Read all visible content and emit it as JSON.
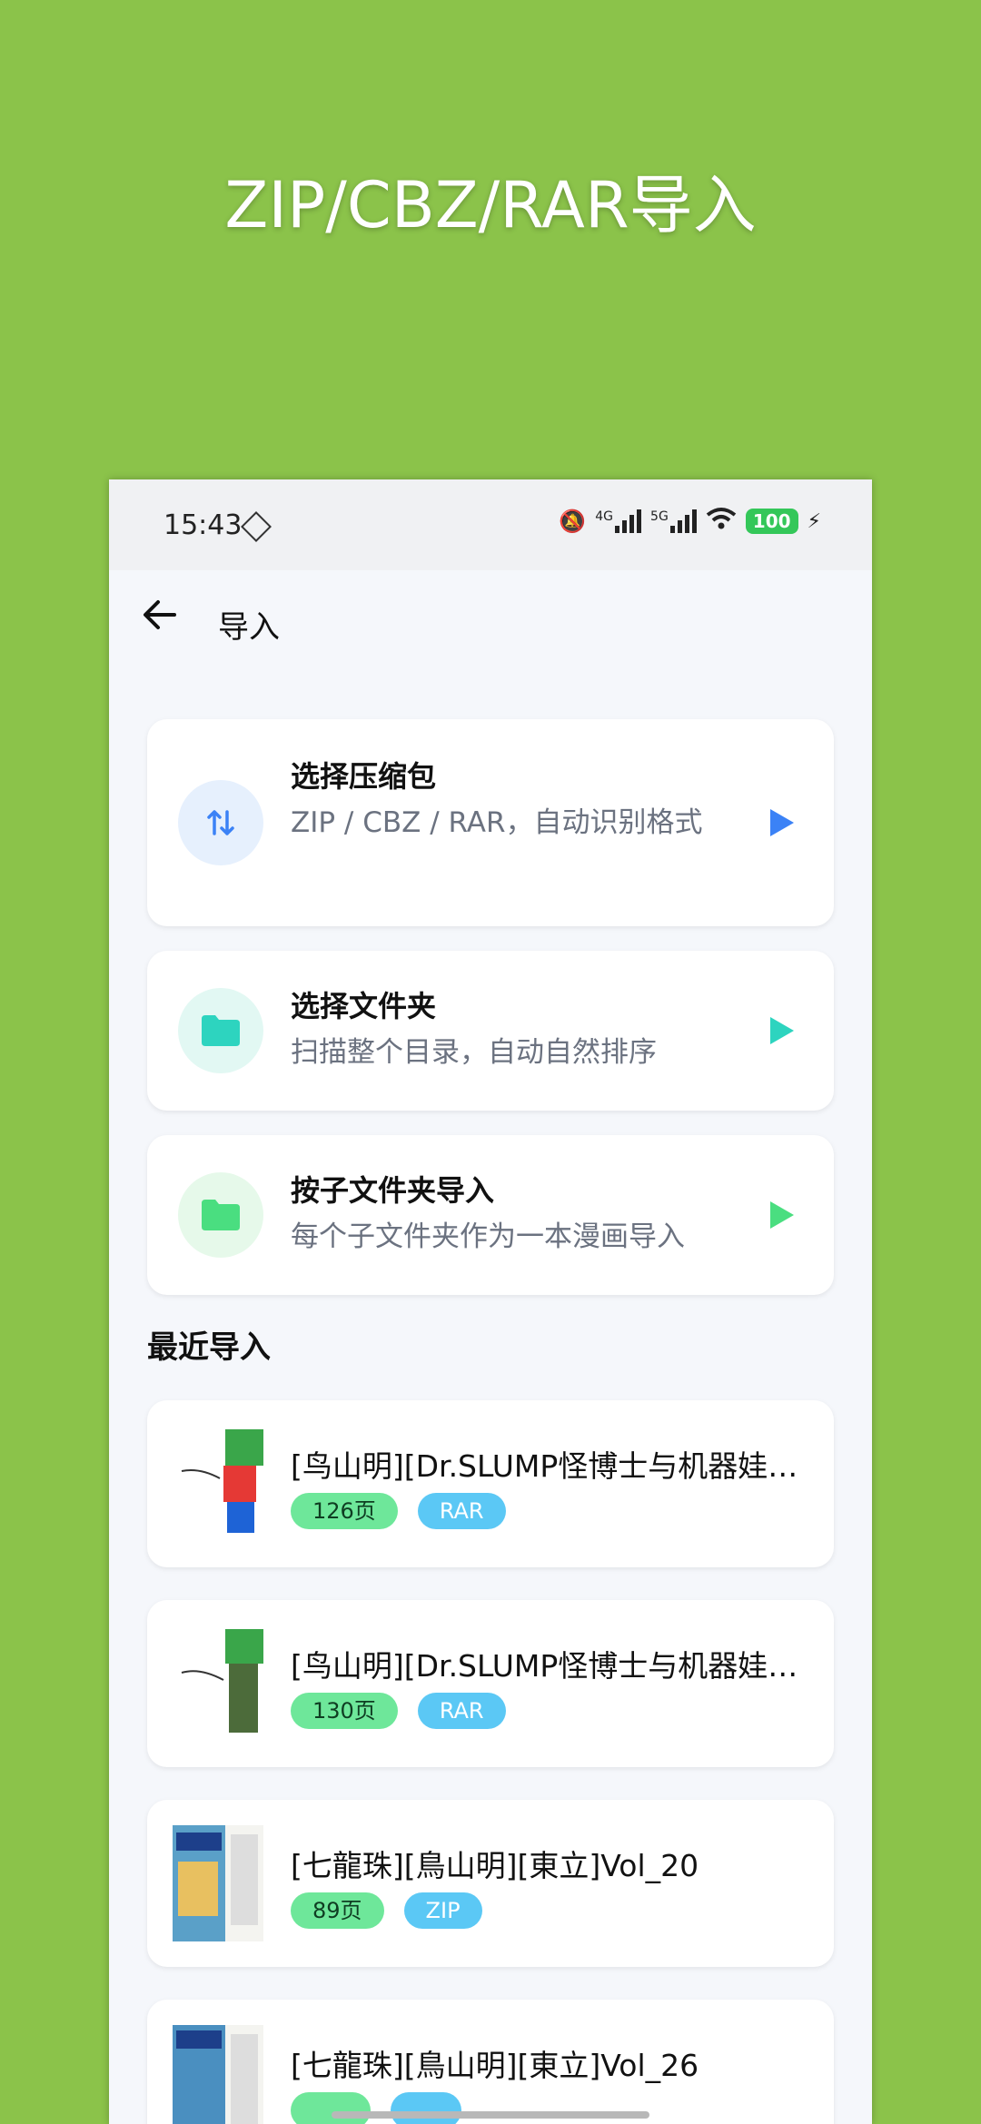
{
  "headline": "ZIP/CBZ/RAR导入",
  "status": {
    "time": "15:43",
    "net1": "4G",
    "net2": "5G",
    "battery": "100"
  },
  "topbar": {
    "title": "导入"
  },
  "options": [
    {
      "title": "选择压缩包",
      "subtitle": "ZIP / CBZ / RAR，自动识别格式",
      "icon": "swap-vert-icon",
      "accent": "#3b82f6",
      "icon_bg": "#e6f0fd"
    },
    {
      "title": "选择文件夹",
      "subtitle": "扫描整个目录，自动自然排序",
      "icon": "folder-icon",
      "accent": "#2dd4bf",
      "icon_bg": "#e2f8f3"
    },
    {
      "title": "按子文件夹导入",
      "subtitle": "每个子文件夹作为一本漫画导入",
      "icon": "folder-icon",
      "accent": "#4ade80",
      "icon_bg": "#e6f9ea"
    }
  ],
  "recent": {
    "heading": "最近导入",
    "items": [
      {
        "title": "[鸟山明][Dr.SLUMP怪博士与机器娃娃]",
        "pages": "126页",
        "format": "RAR"
      },
      {
        "title": "[鸟山明][Dr.SLUMP怪博士与机器娃娃]",
        "pages": "130页",
        "format": "RAR"
      },
      {
        "title": "[七龍珠][鳥山明][東立]Vol_20",
        "pages": "89页",
        "format": "ZIP"
      },
      {
        "title": "[七龍珠][鳥山明][東立]Vol_26",
        "pages": "",
        "format": ""
      }
    ]
  }
}
